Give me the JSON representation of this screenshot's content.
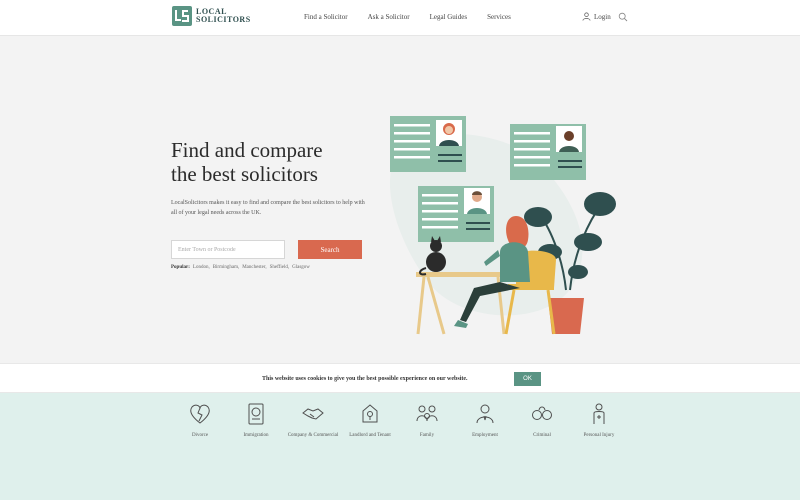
{
  "header": {
    "logo_line1": "LOCAL",
    "logo_line2": "SOLICITORS",
    "nav": [
      "Find a Solicitor",
      "Ask a Solicitor",
      "Legal Guides",
      "Services"
    ],
    "login_label": "Login"
  },
  "hero": {
    "title_line1": "Find and compare",
    "title_line2": "the best solicitors",
    "description": "LocalSolicitors makes it easy to find and compare the best solicitors to help with all of your legal needs across the UK.",
    "search_placeholder": "Enter Town or Postcode",
    "search_button": "Search",
    "popular_label": "Popular:",
    "popular_links": [
      "London,",
      "Birmingham,",
      "Manchester,",
      "Sheffield,",
      "Glasgow"
    ]
  },
  "cookie": {
    "text": "This website uses cookies to give you the best possible experience on our website.",
    "ok_label": "OK"
  },
  "categories": [
    {
      "label": "Divorce",
      "icon": "broken-heart-icon"
    },
    {
      "label": "Immigration",
      "icon": "passport-icon"
    },
    {
      "label": "Company & Commercial",
      "icon": "handshake-icon"
    },
    {
      "label": "Landlord and Tenant",
      "icon": "keys-icon"
    },
    {
      "label": "Family",
      "icon": "family-icon"
    },
    {
      "label": "Employment",
      "icon": "employee-icon"
    },
    {
      "label": "Criminal",
      "icon": "handcuffs-icon"
    },
    {
      "label": "Personal Injury",
      "icon": "injured-person-icon"
    }
  ],
  "colors": {
    "accent": "#d9694f",
    "teal": "#5a9484",
    "card_green": "#8fbfa9",
    "footer_bg": "#dff0ec"
  }
}
